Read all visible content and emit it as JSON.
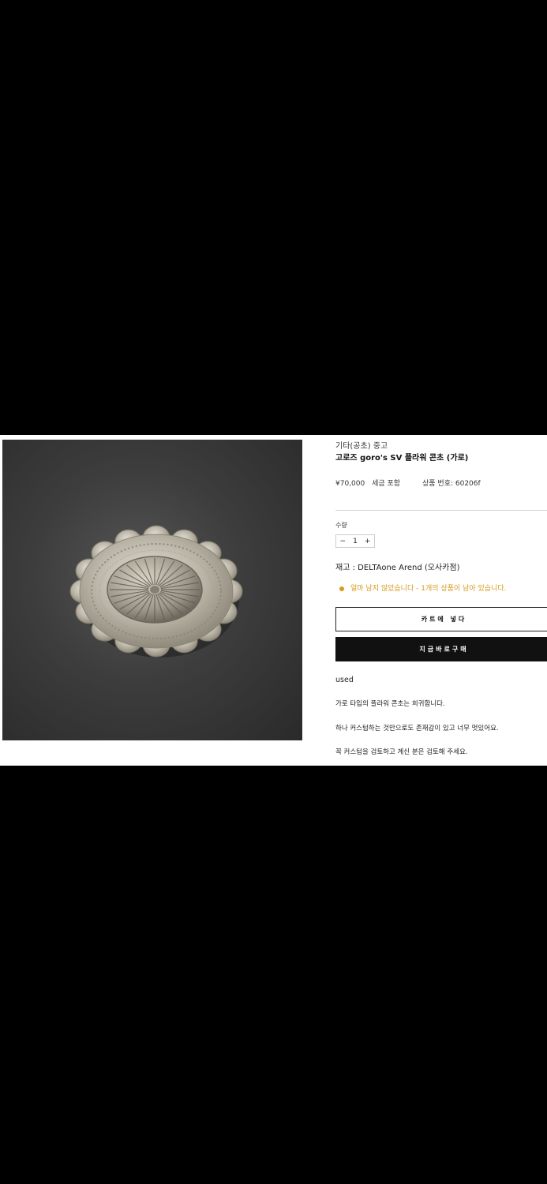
{
  "product": {
    "category": "기타(공초) 중고",
    "title": "고로즈 goro's SV 플라워 콘초 (가로)",
    "price": "¥70,000",
    "tax_note": "세금 포함",
    "sku": "상품 번호: 60206f",
    "image_icon": "concho-photo"
  },
  "quantity": {
    "label": "수량",
    "minus": "−",
    "value": "1",
    "plus": "+"
  },
  "stock": {
    "text": "재고 : DELTAone Arend (오사카점)",
    "notice": "얼마 남지 않았습니다 - 1개의 상품이 남아 있습니다.",
    "notice_color": "#d79a1c"
  },
  "buttons": {
    "add_to_cart": "카트에 넣다",
    "buy_now": "지금바로구매"
  },
  "description": {
    "condition": "used",
    "line1": "가로 타입의 플라워 콘초는 희귀합니다.",
    "line2": "하나 커스텀하는 것만으로도 존재감이 있고 너무 멋있어요.",
    "line3": "꼭 커스텀을 검토하고 계신 분은 검토해 주세요."
  }
}
